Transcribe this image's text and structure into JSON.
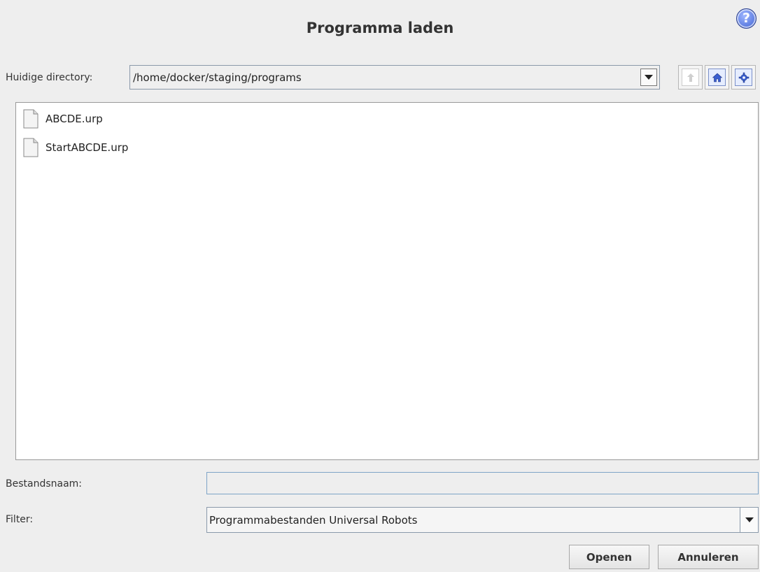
{
  "dialog": {
    "title": "Programma laden",
    "help_glyph": "?"
  },
  "directory": {
    "label": "Huidige directory:",
    "path": "/home/docker/staging/programs",
    "icons": [
      "up-arrow-icon",
      "home-icon",
      "gear-icon"
    ]
  },
  "files": [
    {
      "name": "ABCDE.urp",
      "icon": "file-icon"
    },
    {
      "name": "StartABCDE.urp",
      "icon": "file-icon"
    }
  ],
  "filename": {
    "label": "Bestandsnaam:",
    "value": ""
  },
  "filter": {
    "label": "Filter:",
    "selected": "Programmabestanden Universal Robots"
  },
  "buttons": {
    "open": "Openen",
    "cancel": "Annuleren"
  },
  "colors": {
    "accent": "#3b5fd0",
    "background": "#eeeeee"
  }
}
